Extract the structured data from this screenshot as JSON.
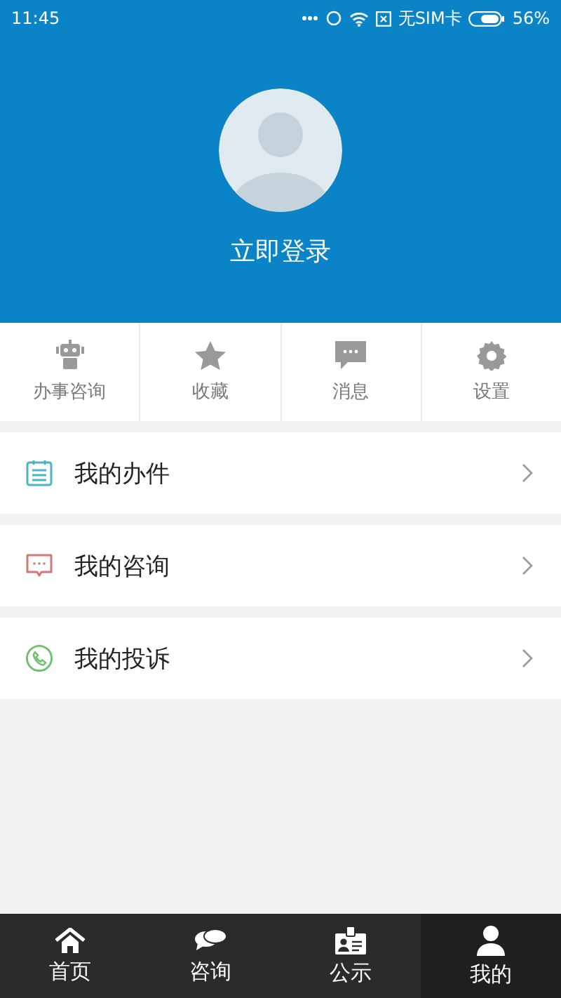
{
  "status_bar": {
    "time": "11:45",
    "carrier": "无SIM卡",
    "battery": "56%"
  },
  "profile": {
    "login": "立即登录"
  },
  "shortcuts": [
    {
      "kind": "robot",
      "label": "办事咨询"
    },
    {
      "kind": "star",
      "label": "收藏"
    },
    {
      "kind": "message",
      "label": "消息"
    },
    {
      "kind": "gear",
      "label": "设置"
    }
  ],
  "menu": [
    {
      "kind": "notepad",
      "label": "我的办件"
    },
    {
      "kind": "chat",
      "label": "我的咨询"
    },
    {
      "kind": "phone",
      "label": "我的投诉"
    }
  ],
  "tabs": [
    {
      "kind": "home",
      "label": "首页",
      "selected": false
    },
    {
      "kind": "chat",
      "label": "咨询",
      "selected": false
    },
    {
      "kind": "badge",
      "label": "公示",
      "selected": false
    },
    {
      "kind": "person",
      "label": "我的",
      "selected": true
    }
  ]
}
